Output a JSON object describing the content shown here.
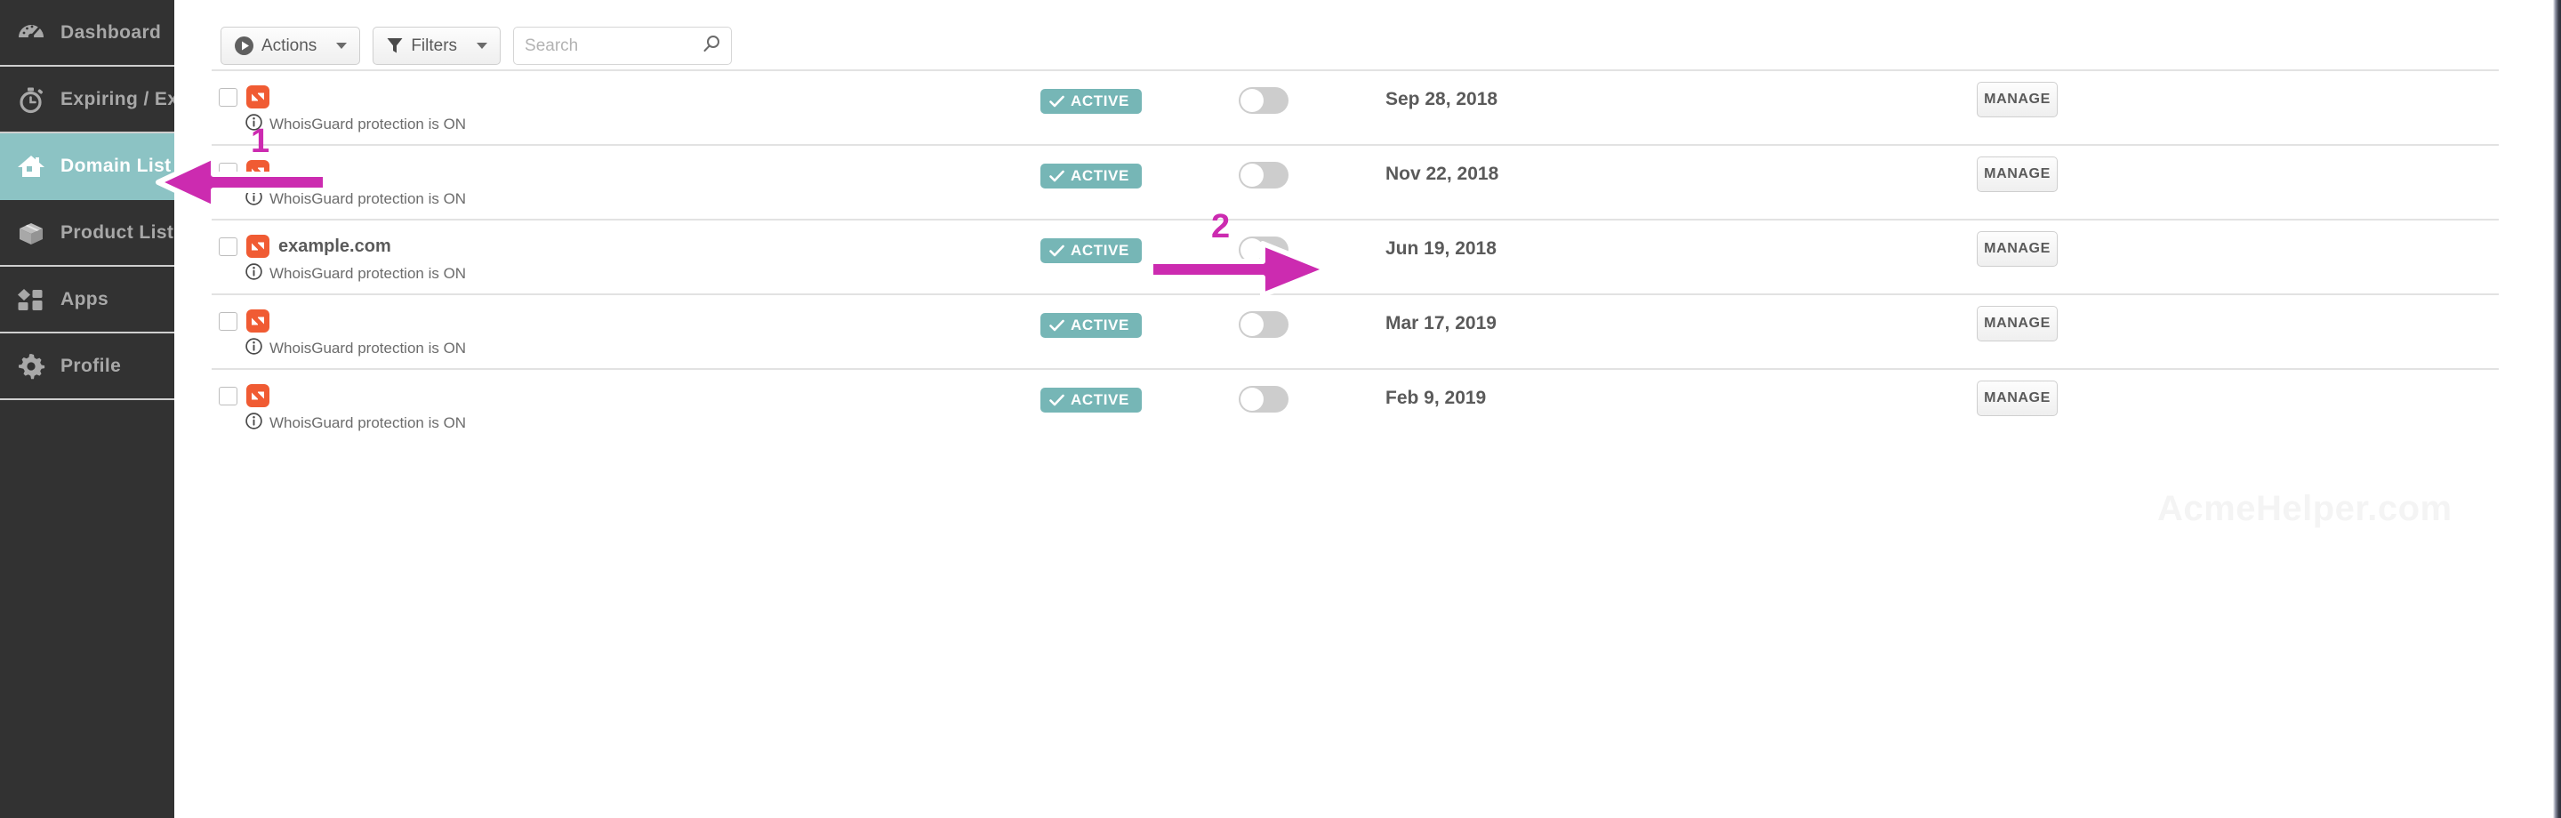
{
  "sidebar": {
    "items": [
      {
        "label": "Dashboard",
        "icon": "gauge-icon",
        "active": false
      },
      {
        "label": "Expiring / Expired",
        "icon": "stopwatch-icon",
        "active": false
      },
      {
        "label": "Domain List",
        "icon": "house-icon",
        "active": true
      },
      {
        "label": "Product List",
        "icon": "box-icon",
        "active": false
      },
      {
        "label": "Apps",
        "icon": "apps-icon",
        "active": false
      },
      {
        "label": "Profile",
        "icon": "gear-icon",
        "active": false
      }
    ]
  },
  "toolbar": {
    "actions_label": "Actions",
    "actions_icon": "play-circle-icon",
    "filters_label": "Filters",
    "filters_icon": "funnel-icon",
    "search_placeholder": "Search",
    "search_value": "",
    "search_icon": "search-icon"
  },
  "table": {
    "manage_label": "MANAGE",
    "status_label": "ACTIVE",
    "whoisguard_note": "WhoisGuard protection is ON",
    "rows": [
      {
        "domain": "",
        "status": "ACTIVE",
        "autorenew": false,
        "date": "Sep 28, 2018",
        "manage": "MANAGE",
        "note": "WhoisGuard protection is ON",
        "checked": false
      },
      {
        "domain": "",
        "status": "ACTIVE",
        "autorenew": false,
        "date": "Nov 22, 2018",
        "manage": "MANAGE",
        "note": "WhoisGuard protection is ON",
        "checked": false
      },
      {
        "domain": "example.com",
        "status": "ACTIVE",
        "autorenew": false,
        "date": "Jun 19, 2018",
        "manage": "MANAGE",
        "note": "WhoisGuard protection is ON",
        "checked": false
      },
      {
        "domain": "",
        "status": "ACTIVE",
        "autorenew": false,
        "date": "Mar 17, 2019",
        "manage": "MANAGE",
        "note": "WhoisGuard protection is ON",
        "checked": false
      },
      {
        "domain": "",
        "status": "ACTIVE",
        "autorenew": false,
        "date": "Feb 9, 2019",
        "manage": "MANAGE",
        "note": "WhoisGuard protection is ON",
        "checked": false
      }
    ]
  },
  "watermark": {
    "text": "AcmeHelper.com"
  },
  "annotations": [
    {
      "number": "1",
      "direction": "left",
      "target": "Domain List"
    },
    {
      "number": "2",
      "direction": "right",
      "target": "MANAGE"
    }
  ],
  "colors": {
    "sidebar_bg": "#323232",
    "sidebar_active": "#8cc3c4",
    "badge_green": "#76b6b6",
    "namecheap_orange": "#f05b33",
    "annotation_magenta": "#cc2bb0",
    "text_gray": "#5a5a5a"
  }
}
